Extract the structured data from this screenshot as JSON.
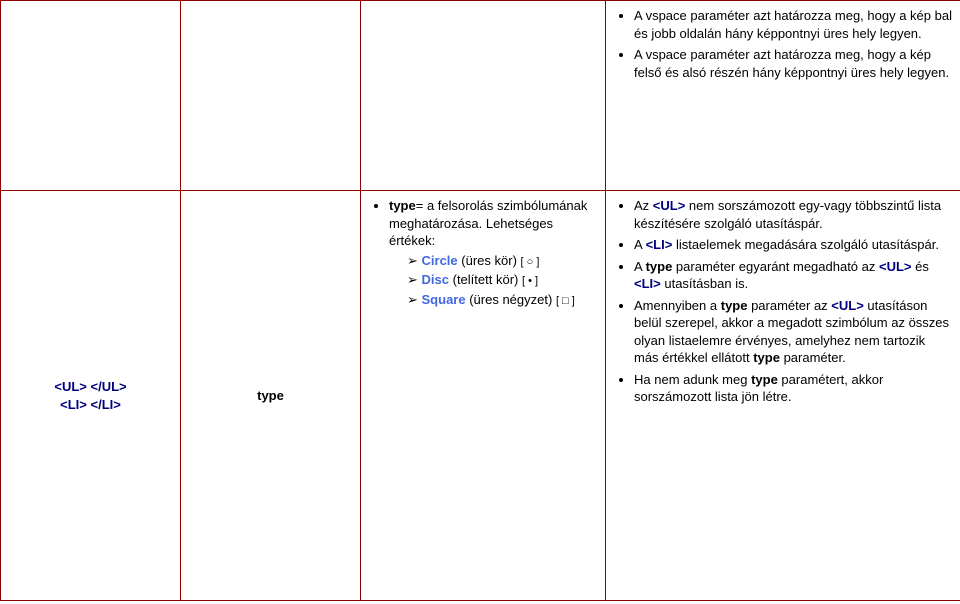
{
  "row1": {
    "col4": {
      "items": [
        "A vspace paraméter azt határozza meg, hogy a kép bal és jobb oldalán hány képpontnyi üres hely legyen.",
        "A vspace paraméter azt határozza meg, hogy a kép felső és alsó részén hány képpontnyi üres hely legyen."
      ]
    }
  },
  "row2": {
    "col1": {
      "line1a": "<UL>",
      "line1b": "</UL>",
      "line2a": "<LI>",
      "line2b": "</LI>"
    },
    "col2": {
      "text": "type"
    },
    "col3": {
      "intro_pre": "type",
      "intro_post": "= a felsorolás szimbólumának meghatározása. Lehetséges értékek:",
      "options": [
        {
          "label": "Circle",
          "desc": "(üres kör)",
          "note": "[ ○ ]"
        },
        {
          "label": "Disc",
          "desc": "(telített kör)",
          "note": "[ • ]"
        },
        {
          "label": "Square",
          "desc": "(üres négyzet)",
          "note": "[ □ ]"
        }
      ]
    },
    "col4": {
      "items": [
        {
          "pre": "Az ",
          "tag": "<UL>",
          "post": " nem sorszámozott egy-vagy többszintű lista készítésére szolgáló utasításpár."
        },
        {
          "pre": "A ",
          "tag": "<LI>",
          "post": " listaelemek megadására szolgáló utasításpár."
        },
        {
          "pre": "A ",
          "tag1": "type",
          "mid1": " paraméter egyaránt megadható az ",
          "tag2": "<UL>",
          "mid2": " és ",
          "tag3": "<LI>",
          "post": " utasításban is."
        },
        {
          "pre": "Amennyiben a ",
          "tag1": "type",
          "mid1": " paraméter az ",
          "tag2": "<UL>",
          "mid2": " utasításon belül szerepel, akkor a megadott szimbólum az összes olyan listaelemre érvényes, amelyhez nem tartozik más értékkel ellátott ",
          "tag3": "type",
          "post": " paraméter."
        },
        {
          "pre": "Ha nem adunk meg ",
          "tag1": "type",
          "post": " paramétert, akkor sorszámozott lista jön létre."
        }
      ]
    }
  }
}
